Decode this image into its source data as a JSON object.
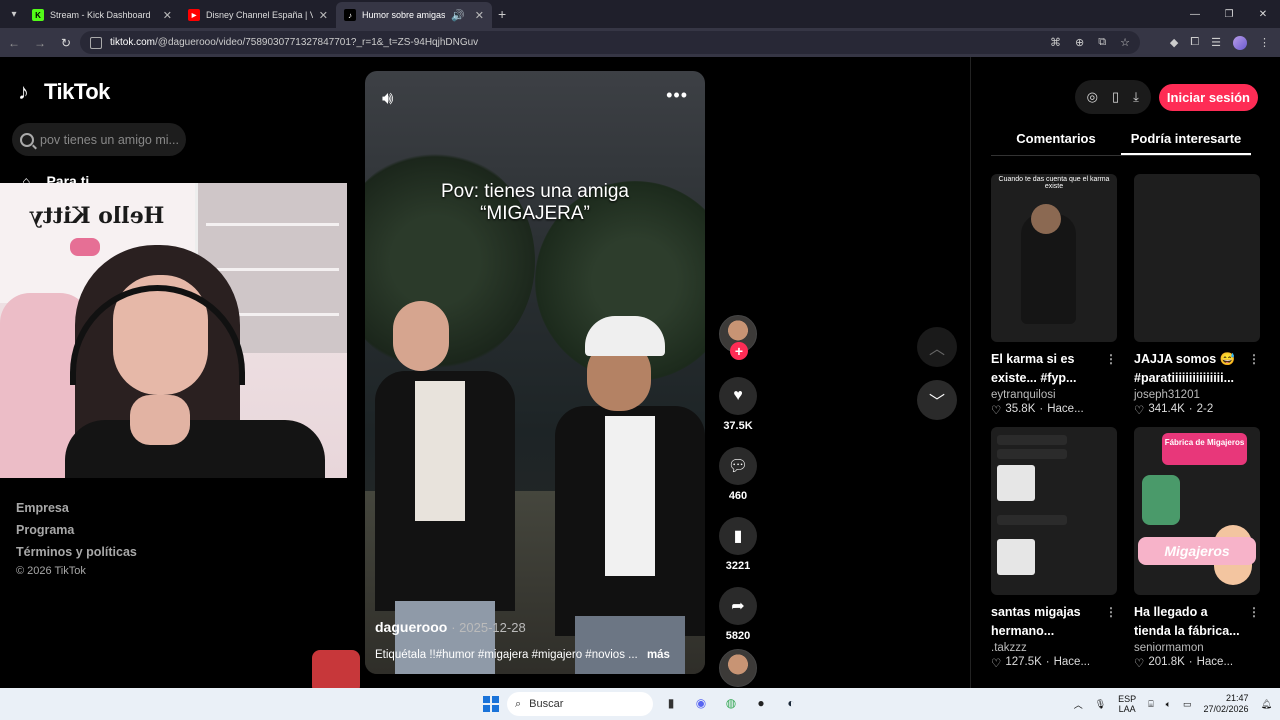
{
  "browser": {
    "tabs": [
      {
        "title": "Stream - Kick Dashboard",
        "fav_color": "#53fc18",
        "fav_glyph": "K"
      },
      {
        "title": "Disney Channel España | Vídeos",
        "fav_color": "#ff0000",
        "fav_glyph": "▶"
      },
      {
        "title": "Humor sobre amigas migajeras",
        "fav_color": "#000000",
        "fav_glyph": "♪"
      }
    ],
    "url_host": "tiktok.com",
    "url_path": "/@daguerooo/video/7589030771327847701?_r=1&_t=ZS-94HqjhDNGuv"
  },
  "sidebar": {
    "logo_text": "TikTok",
    "search_placeholder": "pov tienes un amigo mi...",
    "nav_foryou": "Para ti",
    "footer": {
      "empresa": "Empresa",
      "programa": "Programa",
      "terminos": "Términos y políticas",
      "copyright": "© 2026 TikTok"
    }
  },
  "video": {
    "caption_line1": "Pov: tienes una amiga",
    "caption_line2": "“MIGAJERA”",
    "author": "daguerooo",
    "date": "· 2025-12-28",
    "description": "Etiquétala !!#humor #migajera #migajero #novios ...",
    "more": "más"
  },
  "actions": {
    "likes": "37.5K",
    "comments": "460",
    "saves": "3221",
    "shares": "5820"
  },
  "right_panel": {
    "login": "Iniciar sesión",
    "tab_comments": "Comentarios",
    "tab_suggest": "Podría interesarte",
    "cards": [
      {
        "title": "El karma si es existe... #fyp...",
        "user": "eytranquilosi",
        "views": "35.8K",
        "time": "Hace...",
        "thumb_caption": "Cuando te das cuenta que el karma existe"
      },
      {
        "title": "JAJJA somos 😅 #paratiiiiiiiiiiiiiii...",
        "user": "joseph31201",
        "views": "341.4K",
        "time": "2-2"
      },
      {
        "title": "santas migajas hermano...",
        "user": ".takzzz",
        "views": "127.5K",
        "time": "Hace..."
      },
      {
        "title": "Ha llegado a tienda la fábrica...",
        "user": "seniormamon",
        "views": "201.8K",
        "time": "Hace...",
        "thumb_sign": "Fábrica de Migajeros",
        "thumb_logo": "Migajeros"
      }
    ]
  },
  "taskbar": {
    "search": "Buscar",
    "lang1": "ESP",
    "lang2": "LAA",
    "time": "21:47",
    "date": "27/02/2026"
  }
}
